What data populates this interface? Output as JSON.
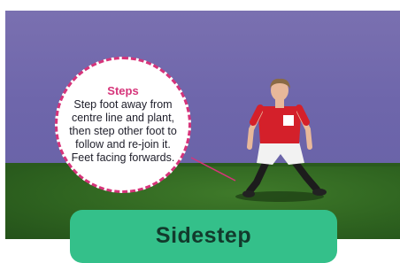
{
  "callout": {
    "title": "Steps",
    "body": "Step foot away from centre line and plant, then step other foot to follow and re-join it. Feet facing forwards."
  },
  "banner": {
    "title": "Sidestep"
  },
  "colors": {
    "accent_pink": "#d6347a",
    "banner_green": "#34c08a",
    "sky_purple": "#6e66ab",
    "grass_green": "#2f6420"
  }
}
